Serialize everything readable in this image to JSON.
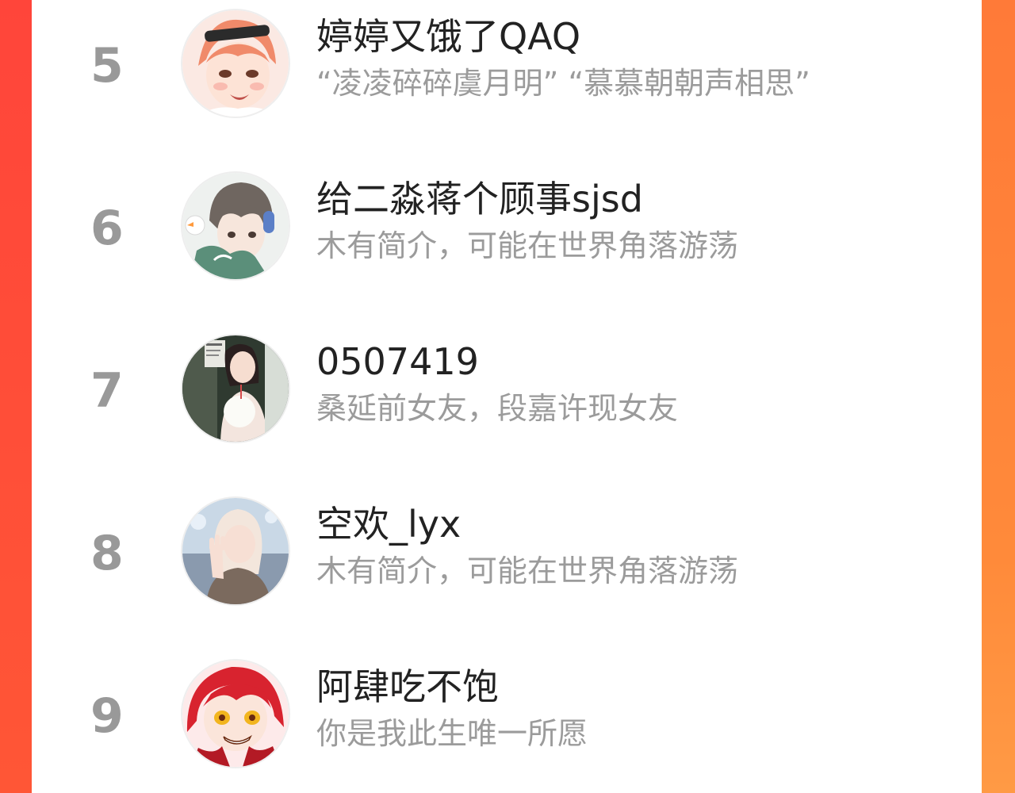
{
  "leaderboard": {
    "entries": [
      {
        "rank": "5",
        "name": "婷婷又饿了QAQ",
        "bio": "“凌凌碎碎虞月明”  “慕慕朝朝声相思”",
        "avatar_icon": "anime-boy-avatar-icon"
      },
      {
        "rank": "6",
        "name": "给二淼蒋个顾事sjsd",
        "bio": "木有简介，可能在世界角落游荡",
        "avatar_icon": "anime-headphones-avatar-icon"
      },
      {
        "rank": "7",
        "name": "0507419",
        "bio": "桑延前女友，段嘉许现女友",
        "avatar_icon": "girl-photo-avatar-icon"
      },
      {
        "rank": "8",
        "name": "空欢_lyx",
        "bio": "木有简介，可能在世界角落游荡",
        "avatar_icon": "girl-waving-avatar-icon"
      },
      {
        "rank": "9",
        "name": "阿肆吃不饱",
        "bio": "你是我此生唯一所愿",
        "avatar_icon": "anime-redhair-avatar-icon"
      }
    ]
  },
  "colors": {
    "background_accent": "#ff5a3c",
    "rank_text": "#999999",
    "name_text": "#222222",
    "bio_text": "#9b9b9b"
  }
}
